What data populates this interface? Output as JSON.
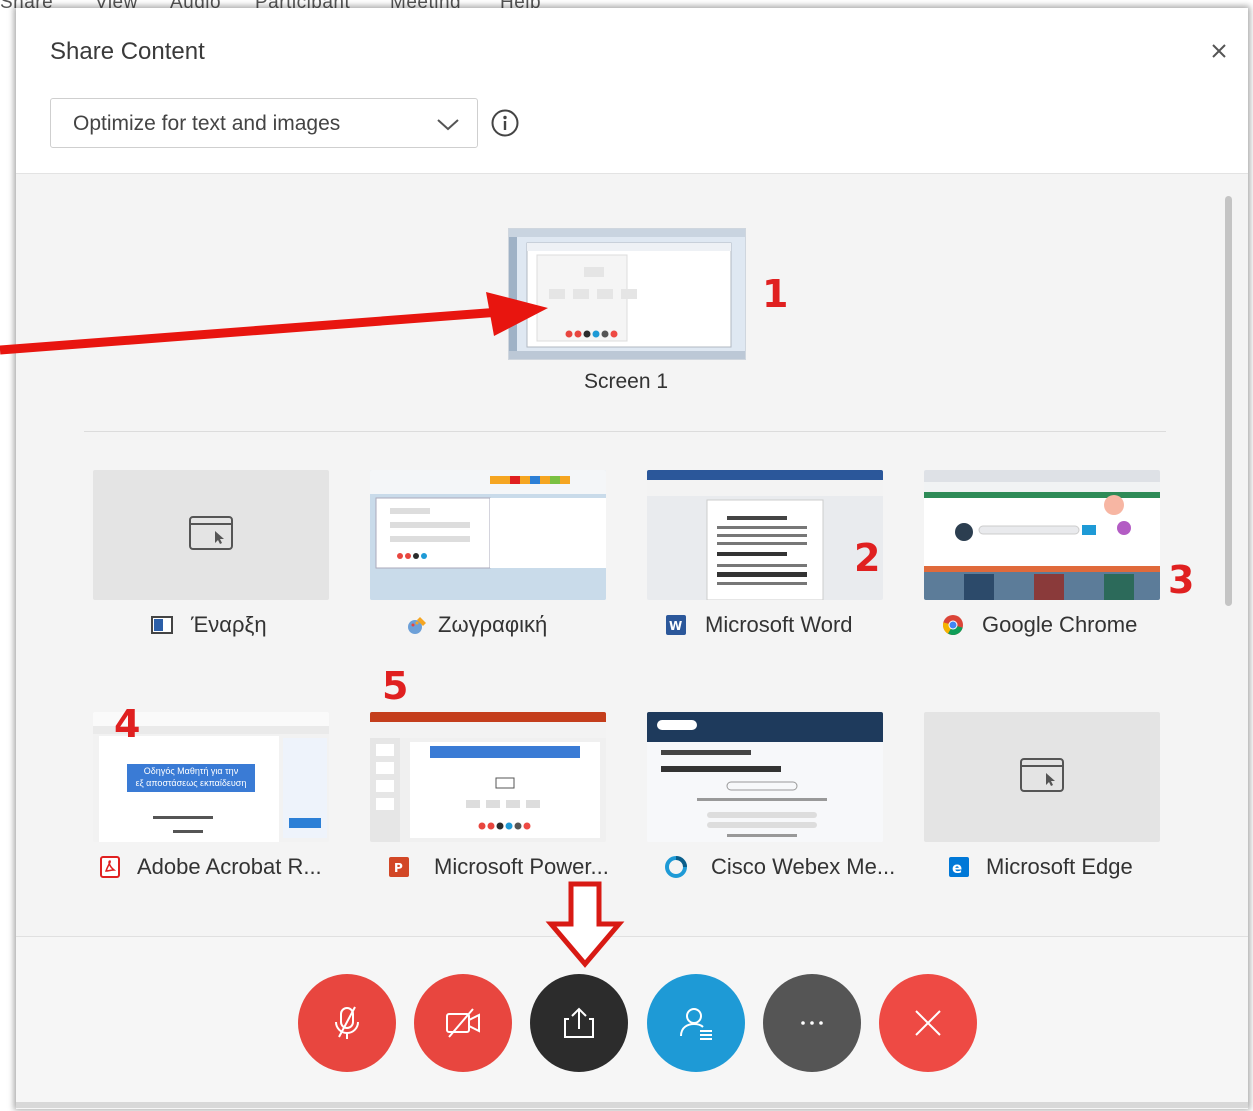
{
  "menubar": {
    "items": [
      "Share",
      "View",
      "Audio",
      "Participant",
      "Meeting",
      "Help"
    ]
  },
  "dialog": {
    "title": "Share Content",
    "optimize_dropdown": {
      "value": "Optimize for text and images"
    }
  },
  "screen": {
    "label": "Screen 1"
  },
  "apps": [
    {
      "label": "Έναρξη",
      "icon": "start-app-icon"
    },
    {
      "label": "Ζωγραφική",
      "icon": "paint-app-icon"
    },
    {
      "label": "Microsoft Word",
      "icon": "word-app-icon"
    },
    {
      "label": "Google Chrome",
      "icon": "chrome-app-icon"
    },
    {
      "label": "Adobe Acrobat R...",
      "icon": "acrobat-app-icon"
    },
    {
      "label": "Microsoft Power...",
      "icon": "powerpoint-app-icon"
    },
    {
      "label": "Cisco Webex Me...",
      "icon": "webex-app-icon"
    },
    {
      "label": "Microsoft Edge",
      "icon": "edge-app-icon"
    }
  ],
  "thumb_text": {
    "acrobat_banner_line1": "Οδηγός Μαθητή για την",
    "acrobat_banner_line2": "εξ αποστάσεως εκπαίδευση"
  },
  "annotations": [
    "1",
    "2",
    "3",
    "4",
    "5"
  ],
  "controls": [
    {
      "name": "mute-button",
      "color": "#e8463f"
    },
    {
      "name": "video-button",
      "color": "#e8463f"
    },
    {
      "name": "share-button",
      "color": "#2c2c2c"
    },
    {
      "name": "participants-button",
      "color": "#1e9ad6"
    },
    {
      "name": "more-button",
      "color": "#555555"
    },
    {
      "name": "leave-button",
      "color": "#ee4a44"
    }
  ],
  "colors": {
    "annotation_red": "#e02020"
  }
}
